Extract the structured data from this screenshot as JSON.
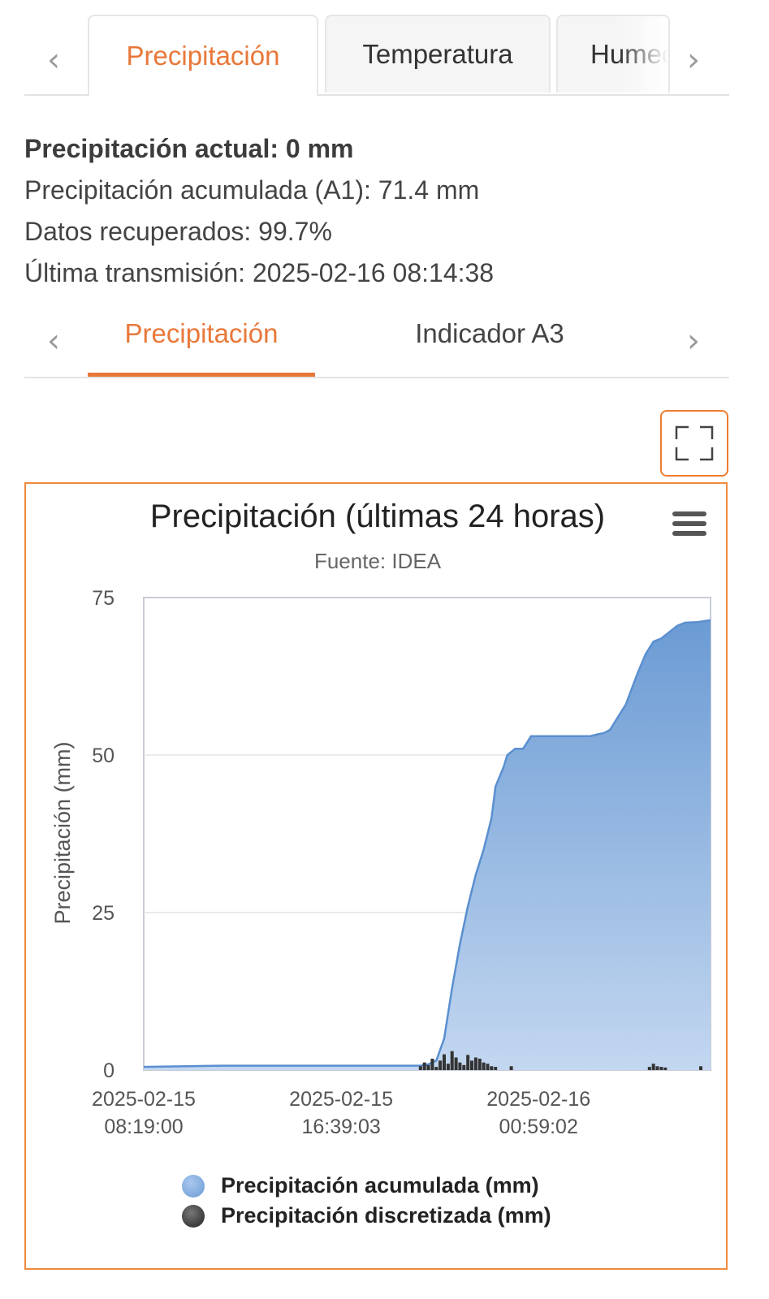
{
  "top_tabs": {
    "items": [
      {
        "label": "Precipitación",
        "active": true
      },
      {
        "label": "Temperatura",
        "active": false
      },
      {
        "label": "Humedad",
        "active": false
      }
    ],
    "prev_icon": "chevron-left-icon",
    "next_icon": "chevron-right-icon"
  },
  "info": {
    "current": "Precipitación actual: 0 mm",
    "accumulated": "Precipitación acumulada (A1): 71.4 mm",
    "recovered": "Datos recuperados: 99.7%",
    "last_transmission": "Última transmisión: 2025-02-16 08:14:38"
  },
  "sub_tabs": {
    "items": [
      {
        "label": "Precipitación",
        "active": true
      },
      {
        "label": "Indicador A3",
        "active": false
      }
    ]
  },
  "fullscreen_icon": "expand-icon",
  "menu_icon": "hamburger-menu-icon",
  "colors": {
    "accent": "#e8783a",
    "area_top": "#6b9bd4",
    "area_bottom": "#c3d7f0",
    "series_discrete": "#333333"
  },
  "chart_data": {
    "type": "area",
    "title": "Precipitación (últimas 24 horas)",
    "subtitle": "Fuente: IDEA",
    "ylabel": "Precipitación (mm)",
    "xlabel": "",
    "ylim": [
      0,
      75
    ],
    "yticks": [
      0,
      25,
      50,
      75
    ],
    "xlim": [
      "2025-02-15 08:19:00",
      "2025-02-16 08:14:38"
    ],
    "xticks": [
      {
        "date": "2025-02-15",
        "time": "08:19:00"
      },
      {
        "date": "2025-02-15",
        "time": "16:39:03"
      },
      {
        "date": "2025-02-16",
        "time": "00:59:02"
      }
    ],
    "grid": true,
    "legend_position": "bottom",
    "series": [
      {
        "name": "Precipitación acumulada (mm)",
        "type": "area",
        "x": [
          "2025-02-15 08:19:00",
          "2025-02-15 11:39:00",
          "2025-02-15 20:00:00",
          "2025-02-15 20:20:00",
          "2025-02-15 20:40:00",
          "2025-02-15 21:00:00",
          "2025-02-15 21:20:00",
          "2025-02-15 21:40:00",
          "2025-02-15 22:00:00",
          "2025-02-15 22:20:00",
          "2025-02-15 22:40:00",
          "2025-02-15 23:00:00",
          "2025-02-15 23:10:00",
          "2025-02-15 23:30:00",
          "2025-02-15 23:40:00",
          "2025-02-15 23:50:00",
          "2025-02-16 00:00:00",
          "2025-02-16 00:20:00",
          "2025-02-16 00:40:00",
          "2025-02-16 01:40:00",
          "2025-02-16 02:20:00",
          "2025-02-16 02:50:00",
          "2025-02-16 03:10:00",
          "2025-02-16 03:30:00",
          "2025-02-16 03:45:00",
          "2025-02-16 04:00:00",
          "2025-02-16 04:20:00",
          "2025-02-16 04:40:00",
          "2025-02-16 05:10:00",
          "2025-02-16 05:30:00",
          "2025-02-16 05:50:00",
          "2025-02-16 06:10:00",
          "2025-02-16 06:30:00",
          "2025-02-16 06:50:00",
          "2025-02-16 07:10:00",
          "2025-02-16 07:40:00",
          "2025-02-16 08:14:38"
        ],
        "values": [
          0.5,
          0.7,
          0.7,
          0.9,
          1.5,
          5,
          13,
          20,
          26,
          31,
          35,
          40,
          45,
          48,
          50,
          50.5,
          51,
          51,
          53,
          53,
          53,
          53,
          53,
          53.3,
          53.5,
          54,
          56,
          58,
          63,
          66,
          68,
          68.5,
          69.5,
          70.5,
          71,
          71.1,
          71.4
        ]
      },
      {
        "name": "Precipitación discretizada (mm)",
        "type": "column",
        "x": [
          "2025-02-15 20:00:00",
          "2025-02-15 20:10:00",
          "2025-02-15 20:20:00",
          "2025-02-15 20:30:00",
          "2025-02-15 20:40:00",
          "2025-02-15 20:50:00",
          "2025-02-15 21:00:00",
          "2025-02-15 21:10:00",
          "2025-02-15 21:20:00",
          "2025-02-15 21:30:00",
          "2025-02-15 21:40:00",
          "2025-02-15 21:50:00",
          "2025-02-15 22:00:00",
          "2025-02-15 22:10:00",
          "2025-02-15 22:20:00",
          "2025-02-15 22:30:00",
          "2025-02-15 22:40:00",
          "2025-02-15 22:50:00",
          "2025-02-15 23:00:00",
          "2025-02-15 23:10:00",
          "2025-02-15 23:50:00",
          "2025-02-16 05:40:00",
          "2025-02-16 05:50:00",
          "2025-02-16 06:00:00",
          "2025-02-16 06:10:00",
          "2025-02-16 06:20:00",
          "2025-02-16 07:50:00"
        ],
        "values": [
          0.6,
          1.2,
          0.8,
          1.8,
          0.5,
          1.5,
          2.5,
          1.0,
          3.0,
          2.0,
          1.2,
          0.8,
          2.4,
          1.5,
          2.0,
          1.8,
          1.2,
          1.0,
          0.6,
          0.5,
          0.6,
          0.5,
          1.0,
          0.6,
          0.5,
          0.4,
          0.6
        ]
      }
    ]
  }
}
